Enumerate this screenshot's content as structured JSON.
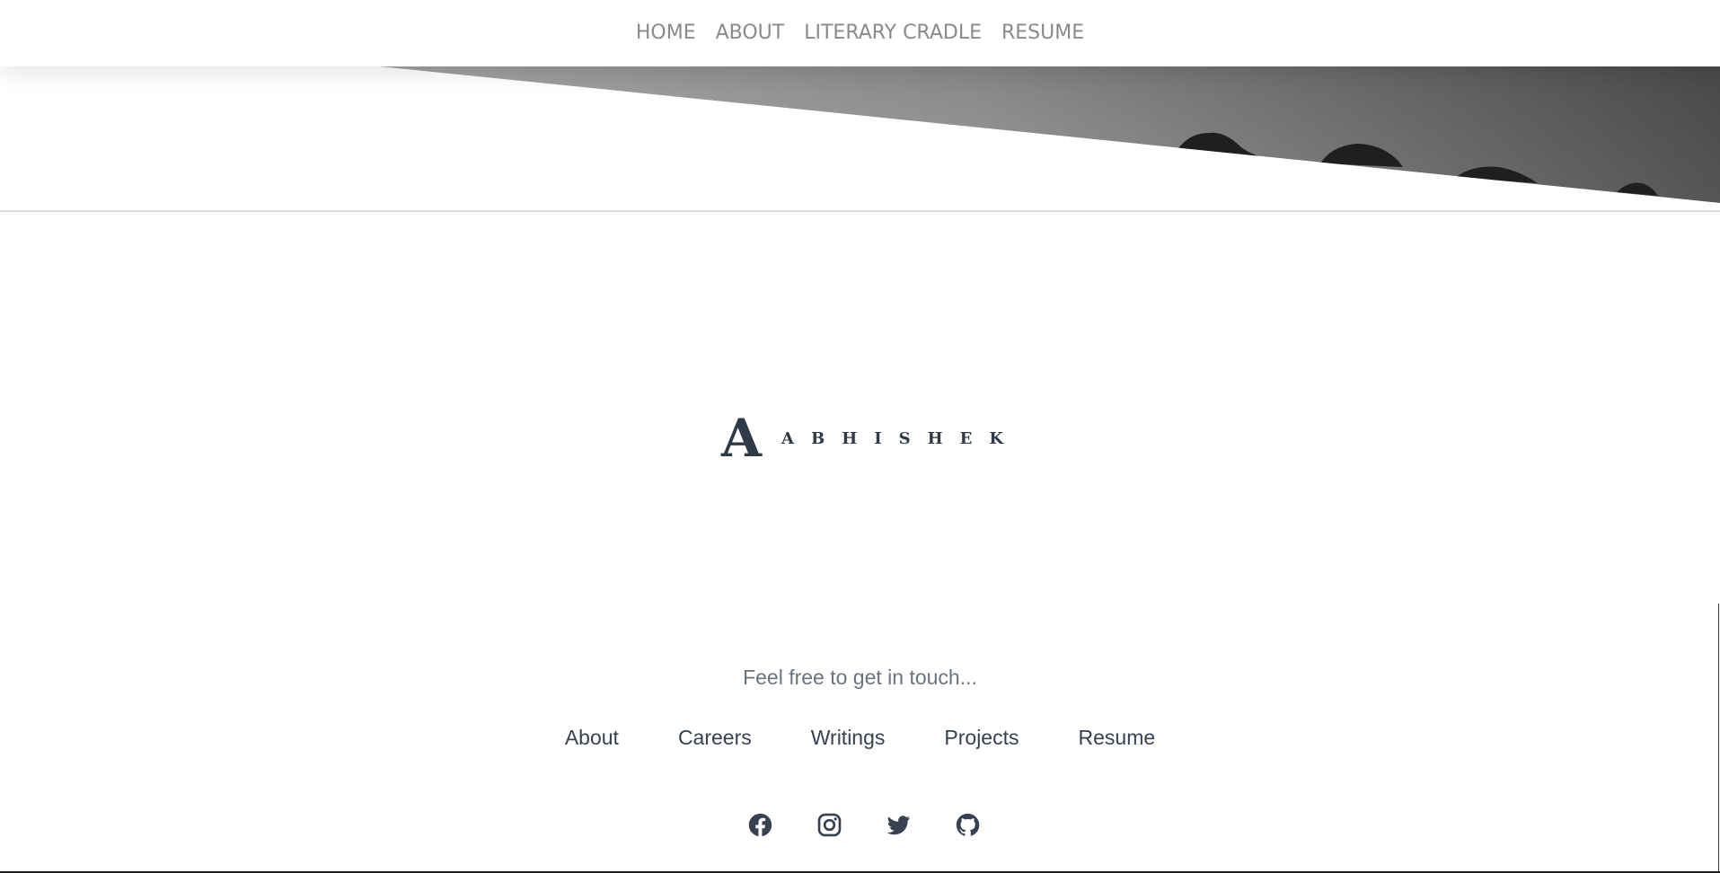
{
  "nav": {
    "items": [
      {
        "label": "HOME"
      },
      {
        "label": "ABOUT"
      },
      {
        "label": "LITERARY CRADLE"
      },
      {
        "label": "RESUME"
      }
    ]
  },
  "logo": {
    "letter": "A",
    "word": "ABHISHEK"
  },
  "footer": {
    "tagline": "Feel free to get in touch...",
    "links": [
      {
        "label": "About"
      },
      {
        "label": "Careers"
      },
      {
        "label": "Writings"
      },
      {
        "label": "Projects"
      },
      {
        "label": "Resume"
      }
    ],
    "socials": [
      {
        "icon": "facebook-icon"
      },
      {
        "icon": "instagram-icon"
      },
      {
        "icon": "twitter-icon"
      },
      {
        "icon": "github-icon"
      }
    ]
  },
  "colors": {
    "nav_text": "#8a8a8a",
    "logo": "#2f3a47",
    "tagline": "#6b7280",
    "footer_link": "#374151",
    "icon": "#374151"
  }
}
